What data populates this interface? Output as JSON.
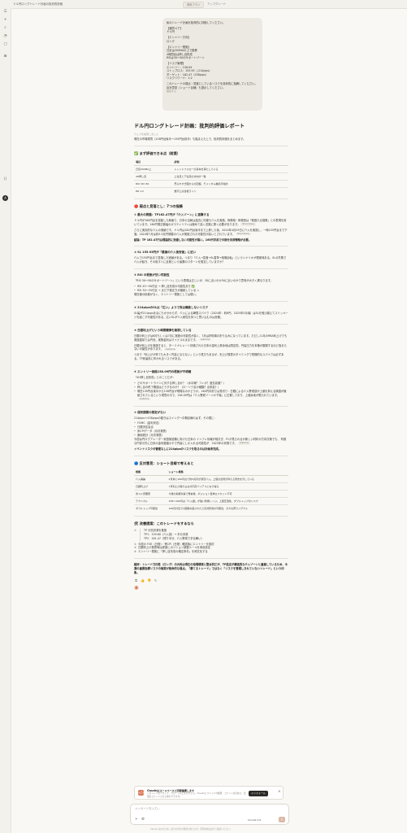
{
  "app": {
    "window_title": "ドル円ロングトレード計画の批判的評価",
    "tabs": [
      "資料プラン",
      "アップグレード"
    ]
  },
  "user_message": {
    "lines": [
      "私のトレード計画を批判的に評価してください。",
      "【通貨ペア】",
      "ドル円",
      "【エントリー方向】",
      "ロング",
      "【エントリー根拠】",
      "日足は20SMAの上で推移",
      "4時間足は押し目形成",
      "RSIは30〜50のサポートゾーン",
      "【リスク管理】",
      "エントリー：158.09",
      "ストップロス：155.95（-214pips）",
      "ターゲット：162.47（438pips）",
      "リスクリワード：1:2",
      "このトレードの弱点・見落としているリスクを具体的に指摘してください。",
      "反対意見（ショート目線）も提示してください。"
    ],
    "edit_label": "編集する"
  },
  "response": {
    "title": "ドル円ロングトレード計画：批判的評価レポート",
    "meta": "ウェブを検索しました",
    "intro": "現在の市場環境（158円台後半〜159円台前半）も踏まえた上で、批判的評価をまとめます。",
    "good_heading": "✅ まず評価できる点（前提）",
    "good_table": {
      "headers": [
        "項目",
        "評価"
      ],
      "rows": [
        [
          "日足20SMA上",
          "トレンドフォローの基本を満たしている"
        ],
        [
          "4H押し目",
          "上位足と下位足の方向が一致"
        ],
        [
          "RSI 30〜50",
          "売られすぎ圏からの回復、モメンタム継続示唆的"
        ],
        [
          "RR 1:2",
          "数字上は合格ライン"
        ]
      ]
    },
    "weak_heading": "🔴 弱点と見落とし：7つの指摘",
    "s1_title": "① 最大の問題：TP162.47円が「介入ゾーン」に直撃する",
    "s1_p1": "ドル円が160円台を突破した局面で、日本の当局は過去に何度も介入を実施。財務相・財務官は「断固たる措置」との表現を用いています。160円周辺値幅のボラティリティは極めて高く念頭に置く必要があります。",
    "s1_p1_cite": "Bloomberg",
    "s1_p2": "さらに実効的な介入の実績です。ドル円は162円台後半まで上昇した後、2024年4月29日に介入を実施し、一時155円台まで下落。2024年7月は約5.5兆円規模の介入が実施された可能性が高いとされています。",
    "s1_p2_cite": "Bloomberg",
    "s1_conclusion": "結論：TP 162.47円は理論的に到達しない可能性が高い。160円手前での部分決済戦略が必要。",
    "s2_title": "② SL 155.95円が「最適の介入後安値」に近い",
    "s2_p": "介入で155円台まで急落した実績がある。つまり「介入→急落→SL直撃→相場反転」というシナリオが現実味ある。SLの失敗で介入が起き、その後すぐに反発という最悪のパターンを想定していますか？",
    "s3_title": "③ RSI の根拠が甘い可能性",
    "s3_p1": "「RSI 30〜50のサポートゾーン」という表現は正しいが、30に近いのか50に近いのかで意味が大きく異なります。",
    "s3_li1": "RSI 45〜50付近 → 押し目完成の可能性あり ✅",
    "s3_li2": "RSI 30〜35付近 → まだ下落圧力が継続している ⚠",
    "s3_p2": "現在値の精度がなく、エントリー根拠としては弱い。",
    "s4_title": "④ 214pipsのSLは「広い」ようで実は機能しないリスク",
    "s4_p": "SL幅が214pipsあるにもかかわらず、介入による瞬間スパイク（2024年：約8円、2025年5月頃）はSLを飛び越えてスリッページを起こす可能性がある。広いSLが介入耐性を持つと思い込むのは危険。",
    "s5_title": "⑤ 日銀利上げという時間爆弾を無視している",
    "s5_p1": "日銀の利上げは6月もしくは7月に実施の可能性が高く、7月は好料購の折り込みになっています。ただし11月のRBA利上げでも実施直前では円安。実際金利はマイナスのままです。",
    "s5_p1_cite": "Gaitame",
    "s5_p2": "日銀が利上げを実施すると、ターミナルレート評価された日本の金利上昇余地は限定的。円高圧力を本格が顕現するほど強まらない可能性があります。",
    "s5_p2_cite": "Gaitame",
    "s5_p3": "つまり「利上げが来ても大きく円高にならない」という見方もあるが、利上げ発表のタイミングで短期的なスパイクは必ずある。TP到達前に叩かれるリスクがある。",
    "s6_title": "⑥ エントリー価格158.09円の根拠が不明確",
    "s6_p": "「4H押し目形成」とのことだが：",
    "s6_li1": "どのサポートラインに対する押し目か？（水平線？フィボ？過去高値？）",
    "s6_li2": "押し目の終了確認はどうするのか？（ローソク足の種類？出来高？）",
    "s6_li3": "現在159円台後半から158円台が現場なのかどうか。160円手前では見切り・日銀による介入警戒感が上値を抑える構図が継続されているという環境の中で、158.09円は「介入警戒ゾーンの下端」に位置しており、上値余地が限られています。",
    "s6_li3_cite": "Gaitame",
    "s7_title": "⑦ 保有期間の想定がない",
    "s7_p": "214pips＋438pipsの動きはスイング〜中期目線のはず。その間に：",
    "s7_li1": "FOMC（金利決定）",
    "s7_li2": "日銀決定会合",
    "s7_li3": "米CPIデータ（月次発表）",
    "s7_li4": "雇用統計（月次発表）",
    "s7_p2": "今週は円ログアレーダー米国家認識に向けた日米の インフレ情報が相次ぎ、FCが見られるが新しい材料か方向次第でも、 有数な円安の先に日米の金利差縮小やで円高にしか入れる可能性が　2025年の状態です。",
    "s7_p2_cite": "Gaitame",
    "s7_conclusion": "イベントリスクの管理なしに214pipsのリスクを取るのは計画未完成。",
    "bear_heading": "🔵 反対意見：ショート目線で考えると",
    "bear_table": {
      "headers": [
        "根拠",
        "ショート根拠"
      ],
      "rows": [
        [
          "介入異論",
          "4月末に160円台で約5兆円が通貨介入。上値は当局が抑える意志を示している"
        ],
        [
          "日銀利上げ",
          "7月利上げ織り込みが円高バイアスになり得る"
        ],
        [
          "米ドル安要因",
          "今後の指標次第で発言後、ポジション自体ロスカット不可"
        ],
        [
          "テクニカル",
          "158〜160円は「介入壁」が強い防衛レンジ。上値圧迫性、ダブルトップのリスク"
        ],
        [
          "ダブルトップ可能性",
          "160円付近で2度跳ね返されたら天井形成の可能性、大きな売りシグナル"
        ]
      ]
    },
    "plan_heading": "🛠 改善提案：このトレードをするなら",
    "plan_box": [
      "TP 分割決済を推奨",
      "TP1：159.80（介入前）→ 半分決済",
      "TP2：161.47（残り半分、介入警戒で手仕舞い）"
    ],
    "plan_items": [
      "今週の FOE（日程）・貿CPI（日程）確認後にエントリーを検討",
      "日銀利上げ発表時は即座にポジション調整ルールを事前設定",
      "エントリー根拠に「押し目完成の確定条件」を明文化する"
    ],
    "final_summary": "総評：トレード方向性（ロング）の大枠は現在の相場環境と整合的だが、TP設定が構造的な介入ゾーンと重複しているため、今週の重要指標リスクの無策が致命的な弱点。「勝てるトレード」ではなく「リスクを管理しきれていないトレード」という印象。"
  },
  "promo": {
    "title": "Claudeはコードベースと同期連携します",
    "body": "リポジトリをアタッチ、クローンなどをせずとも、Claudeにファイルや履歴、コミットを自在に、変更をコミットさせる事ができます。",
    "button": "インストール"
  },
  "composer": {
    "placeholder": "メッセージを入力...",
    "model": "Sonnet 4.6"
  },
  "footer": "Claude はAIのため、誤りを含む可能性があります。回答内容は必ずご確認ください。"
}
